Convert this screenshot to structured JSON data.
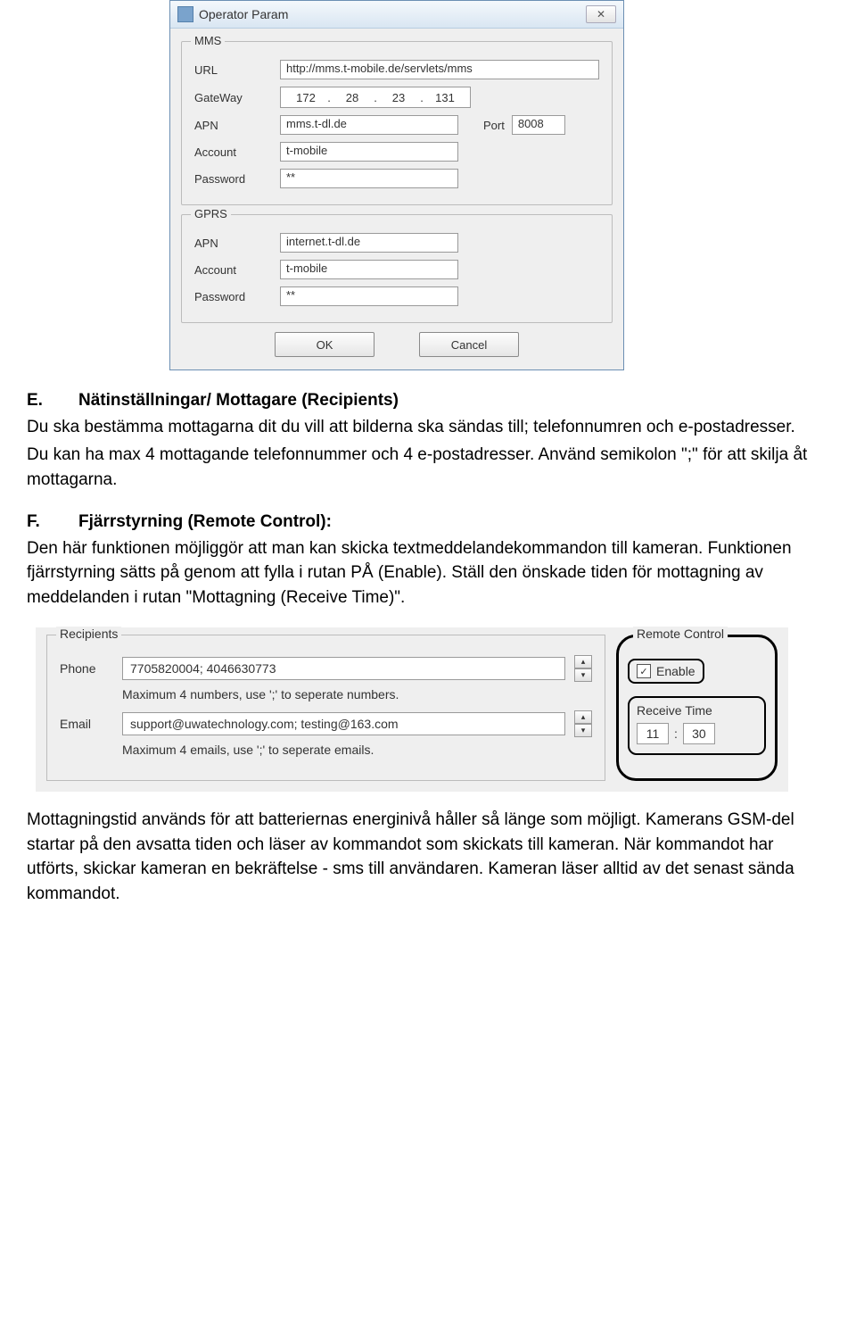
{
  "dialog": {
    "title": "Operator Param",
    "close": "✕",
    "mms": {
      "legend": "MMS",
      "url_label": "URL",
      "url_value": "http://mms.t-mobile.de/servlets/mms",
      "gateway_label": "GateWay",
      "gw": [
        "172",
        "28",
        "23",
        "131"
      ],
      "dot": ".",
      "apn_label": "APN",
      "apn_value": "mms.t-dl.de",
      "port_label": "Port",
      "port_value": "8008",
      "account_label": "Account",
      "account_value": "t-mobile",
      "password_label": "Password",
      "password_value": "**"
    },
    "gprs": {
      "legend": "GPRS",
      "apn_label": "APN",
      "apn_value": "internet.t-dl.de",
      "account_label": "Account",
      "account_value": "t-mobile",
      "password_label": "Password",
      "password_value": "**"
    },
    "ok": "OK",
    "cancel": "Cancel"
  },
  "section_e": {
    "letter": "E.",
    "heading": "Nätinställningar/ Mottagare (Recipients)",
    "p1": "Du ska bestämma mottagarna dit du vill att bilderna ska sändas till; telefonnumren och e-postadresser.",
    "p2": "Du kan ha max 4 mottagande telefonnummer och 4 e-postadresser. Använd semikolon \";\" för att skilja åt mottagarna."
  },
  "section_f": {
    "letter": "F.",
    "heading": "Fjärrstyrning (Remote Control):",
    "p1": "Den här funktionen möjliggör att man kan skicka textmeddelandekommandon till kameran. Funktionen fjärrstyrning sätts på genom att fylla i rutan PÅ (Enable). Ställ den önskade tiden för mottagning av meddelanden i rutan \"Mottagning (Receive Time)\"."
  },
  "panel2": {
    "recipients_legend": "Recipients",
    "phone_label": "Phone",
    "phone_value": "7705820004; 4046630773",
    "phone_hint": "Maximum 4 numbers, use ';' to seperate numbers.",
    "email_label": "Email",
    "email_value": "support@uwatechnology.com; testing@163.com",
    "email_hint": "Maximum 4 emails, use ';' to seperate emails.",
    "remote_legend": "Remote Control",
    "enable_label": "Enable",
    "check": "✓",
    "receive_time_label": "Receive Time",
    "hour": "11",
    "colon": ":",
    "minute": "30",
    "up": "▴",
    "down": "▾"
  },
  "footer": {
    "p": "Mottagningstid används för att batteriernas energinivå håller så länge som möjligt. Kamerans GSM-del startar på den avsatta tiden och läser av kommandot som skickats till kameran. När kommandot har utförts, skickar kameran en bekräftelse - sms till användaren. Kameran läser alltid av det senast sända kommandot."
  }
}
